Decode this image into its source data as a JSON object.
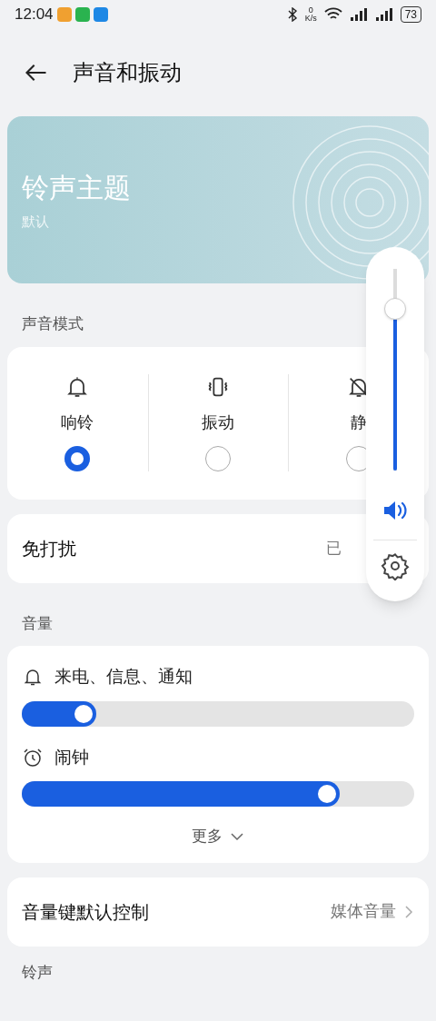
{
  "status_bar": {
    "time": "12:04",
    "speed_value": "0",
    "speed_unit": "K/s",
    "battery": "73"
  },
  "header": {
    "title": "声音和振动"
  },
  "banner": {
    "title": "铃声主题",
    "subtitle": "默认"
  },
  "mode_section": "声音模式",
  "modes": [
    {
      "kind": "ring",
      "label": "响铃",
      "selected": true
    },
    {
      "kind": "vibrate",
      "label": "振动",
      "selected": false
    },
    {
      "kind": "silent",
      "label": "静",
      "selected": false
    }
  ],
  "dnd": {
    "label": "免打扰",
    "value": "已"
  },
  "volume_section": "音量",
  "volumes": [
    {
      "kind": "bell",
      "label": "来电、信息、通知",
      "level": 0.19
    },
    {
      "kind": "alarm",
      "label": "闹钟",
      "level": 0.81
    }
  ],
  "more": "更多",
  "key_control": {
    "label": "音量键默认控制",
    "value": "媒体音量"
  },
  "ringtone_section": "铃声",
  "volume_popup": {
    "level": 0.8
  }
}
